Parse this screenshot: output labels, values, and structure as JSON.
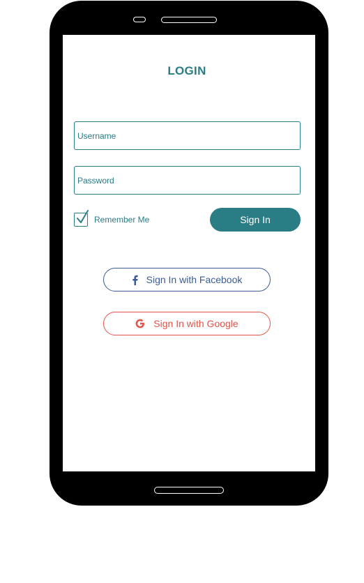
{
  "login": {
    "title": "LOGIN",
    "username_placeholder": "Username",
    "password_placeholder": "Password",
    "remember_label": "Remember Me",
    "remember_checked": true,
    "sign_in_label": "Sign In",
    "facebook_label": "Sign In with Facebook",
    "google_label": "Sign In with Google"
  },
  "icons": {
    "facebook": "facebook-icon",
    "google": "google-icon",
    "check": "checkmark-icon"
  },
  "colors": {
    "accent": "#2a7c85",
    "facebook": "#3b5b96",
    "google": "#e2534a",
    "phone_frame": "#000000"
  }
}
